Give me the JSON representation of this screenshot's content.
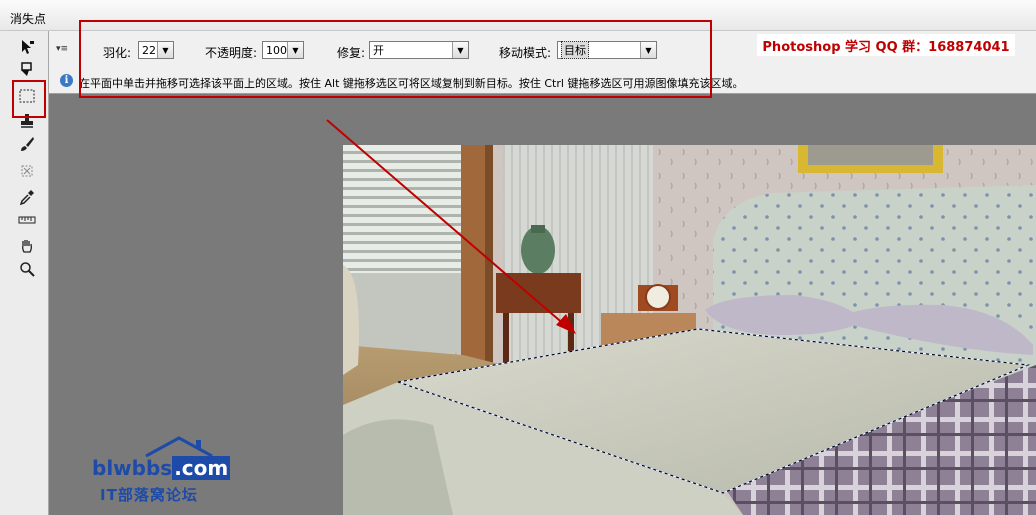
{
  "window": {
    "title": "消失点"
  },
  "options": {
    "feather_label": "羽化:",
    "feather_value": "22",
    "opacity_label": "不透明度:",
    "opacity_value": "100",
    "heal_label": "修复:",
    "heal_value": "开",
    "move_mode_label": "移动模式:",
    "move_mode_value": "目标"
  },
  "hint": {
    "icon": "info-icon",
    "text": "在平面中单击并拖移可选择该平面上的区域。按住 Alt 键拖移选区可将区域复制到新目标。按住 Ctrl 键拖移选区可用源图像填充该区域。"
  },
  "brand": {
    "text": "Photoshop 学习 QQ 群：168874041"
  },
  "watermark": {
    "domain_main": "blwbbs",
    "domain_suffix": ".com",
    "subtitle": "IT部落窝论坛"
  },
  "tools": [
    "edit-plane-tool-icon",
    "create-plane-tool-icon",
    "marquee-tool-icon",
    "stamp-tool-icon",
    "brush-tool-icon",
    "transform-tool-icon",
    "eyedropper-tool-icon",
    "measure-tool-icon",
    "hand-tool-icon",
    "zoom-tool-icon"
  ],
  "colors": {
    "annotation_red": "#c00000",
    "plane_outline": "#5a78d8",
    "brand_blue": "#1e4aa8"
  }
}
